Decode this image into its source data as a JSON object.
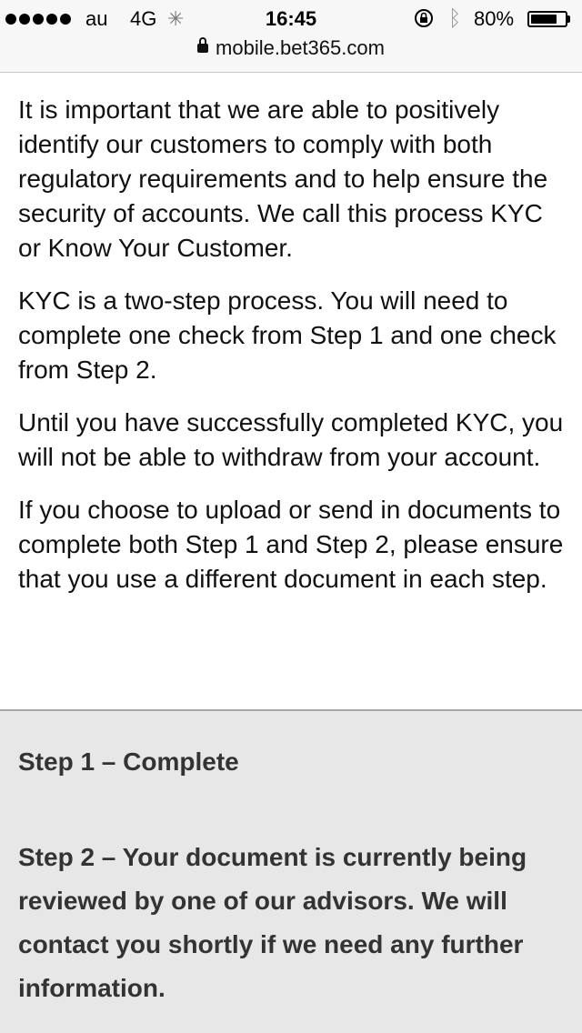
{
  "status_bar": {
    "carrier": "au",
    "network": "4G",
    "time": "16:45",
    "battery": "80%",
    "battery_level": 0.8
  },
  "browser": {
    "url": "mobile.bet365.com"
  },
  "main": {
    "paragraphs": [
      "It is important that we are able to positively identify our customers to comply with both regulatory requirements and to help ensure the security of accounts. We call this process KYC or Know Your Customer.",
      "KYC is a two-step process. You will need to complete one check from Step 1 and one check from Step 2.",
      "Until you have successfully completed KYC, you will not be able to withdraw from your account.",
      "If you choose to upload or send in documents to complete both Step 1 and Step 2, please ensure that you use a different document in each step."
    ]
  },
  "steps": {
    "step1": "Step 1 – Complete",
    "step2": "Step 2 – Your document is currently being reviewed by one of our advisors. We will contact you shortly if we need any further information."
  },
  "icons": [
    "signal-dots-icon",
    "activity-spinner-icon",
    "rotation-lock-icon",
    "bluetooth-icon",
    "battery-icon",
    "padlock-icon"
  ]
}
